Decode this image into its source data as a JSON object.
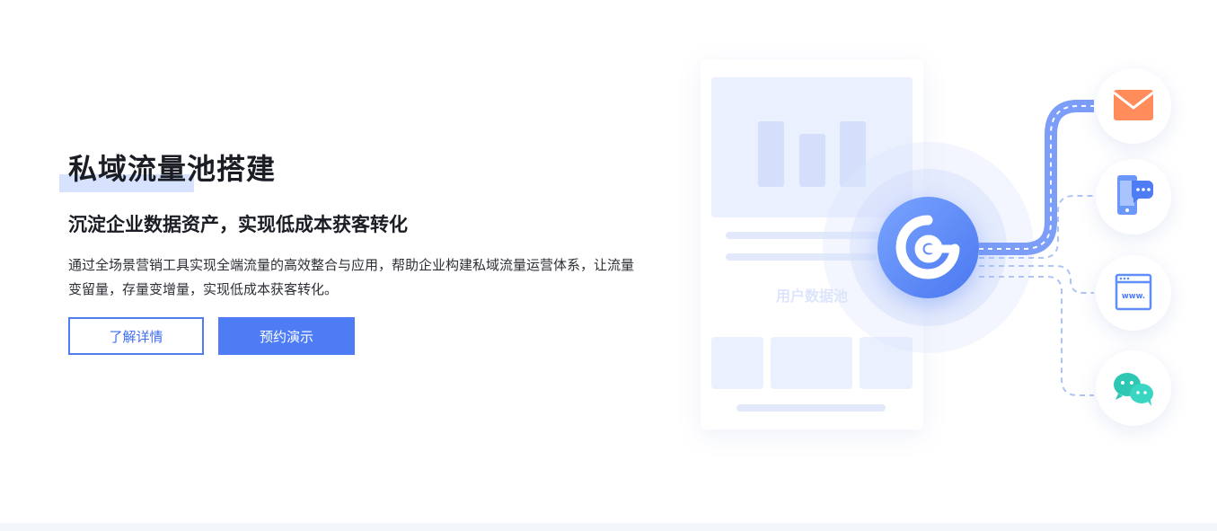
{
  "hero": {
    "title": "私域流量池搭建",
    "subtitle": "沉淀企业数据资产，实现低成本获客转化",
    "description": "通过全场景营销工具实现全端流量的高效整合与应用，帮助企业构建私域流量运营体系，让流量变留量，存量变增量，实现低成本获客转化。",
    "buttons": {
      "learn_more": "了解详情",
      "book_demo": "预约演示"
    }
  },
  "illustration": {
    "pool_label": "用户数据池",
    "nodes": [
      "email-icon",
      "mobile-chat-icon",
      "website-icon",
      "wechat-icon"
    ],
    "web_badge": "www.",
    "colors": {
      "accent": "#4d7cf5",
      "hub": "#4a78f0",
      "email": "#ff8c5a",
      "wechat": "#2ec7b4"
    }
  }
}
